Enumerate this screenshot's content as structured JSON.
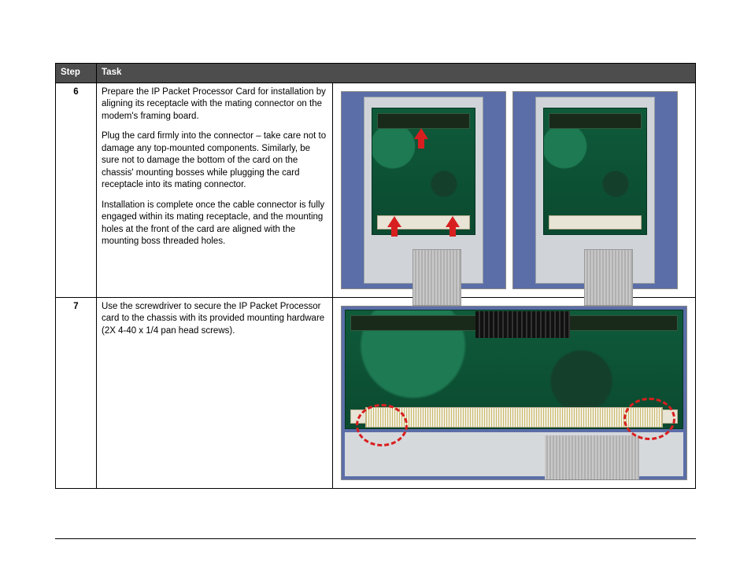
{
  "table": {
    "header": {
      "step": "Step",
      "task": "Task"
    },
    "rows": [
      {
        "step": "6",
        "paragraphs": [
          "Prepare the IP Packet Processor Card for installation by aligning its receptacle with the mating connector on the modem's framing board.",
          "Plug the card firmly into the connector – take care not to damage any top-mounted components. Similarly, be sure not to damage the bottom of the card on the chassis' mounting bosses while plugging the card receptacle into its mating connector.",
          "Installation is complete once the cable connector is fully engaged within its mating receptacle, and the mounting holes at the front of the card are aligned with the mounting boss threaded holes."
        ]
      },
      {
        "step": "7",
        "paragraphs": [
          "Use the screwdriver to secure the IP Packet Processor card to the chassis with its provided mounting hardware (2X 4-40 x 1/4 pan head screws)."
        ]
      }
    ]
  }
}
